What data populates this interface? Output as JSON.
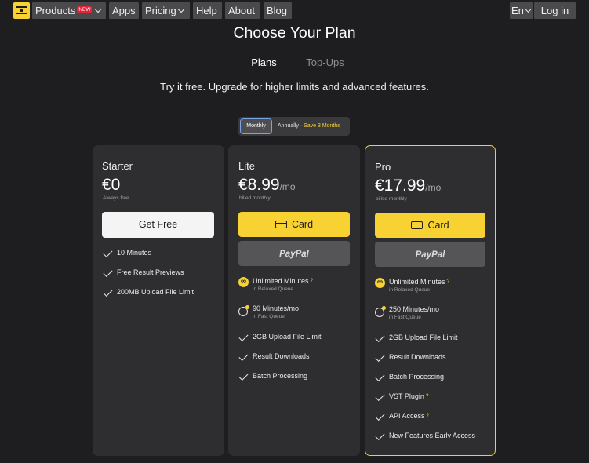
{
  "nav": {
    "products": "Products",
    "new_badge": "NEW",
    "apps": "Apps",
    "pricing": "Pricing",
    "help": "Help",
    "about": "About",
    "blog": "Blog",
    "language": "En",
    "login": "Log in"
  },
  "header": {
    "title": "Choose Your Plan",
    "tabs": [
      "Plans",
      "Top-Ups"
    ],
    "subtitle": "Try it free. Upgrade for higher limits and advanced features."
  },
  "billing": {
    "monthly": "Monthly",
    "annually": "Annually",
    "separator": " · ",
    "save": "Save 3 Months"
  },
  "plans": {
    "starter": {
      "name": "Starter",
      "price": "€0",
      "note": "Always free",
      "button": "Get Free",
      "features": [
        "10 Minutes",
        "Free Result Previews",
        "200MB Upload File Limit"
      ]
    },
    "lite": {
      "name": "Lite",
      "price": "€8.99",
      "per": "/mo",
      "note": "billed monthly",
      "card_button": "Card",
      "paypal_button": "PayPal",
      "features": [
        {
          "text": "Unlimited Minutes",
          "sub": "in Relaxed Queue",
          "info": "?"
        },
        {
          "text": "90 Minutes/mo",
          "sub": "in Fast Queue"
        },
        {
          "text": "2GB Upload File Limit"
        },
        {
          "text": "Result Downloads"
        },
        {
          "text": "Batch Processing"
        }
      ]
    },
    "pro": {
      "name": "Pro",
      "price": "€17.99",
      "per": "/mo",
      "note": "billed monthly",
      "card_button": "Card",
      "paypal_button": "PayPal",
      "features": [
        {
          "text": "Unlimited Minutes",
          "sub": "in Relaxed Queue",
          "info": "?"
        },
        {
          "text": "250 Minutes/mo",
          "sub": "in Fast Queue"
        },
        {
          "text": "2GB Upload File Limit"
        },
        {
          "text": "Result Downloads"
        },
        {
          "text": "Batch Processing"
        },
        {
          "text": "VST Plugin",
          "info": "?"
        },
        {
          "text": "API Access",
          "info": "?"
        },
        {
          "text": "New Features Early Access"
        }
      ]
    }
  },
  "colors": {
    "background": "#1e1d20",
    "card": "#2e2d30",
    "accent": "#f7d232",
    "new_badge": "#e0253a"
  }
}
